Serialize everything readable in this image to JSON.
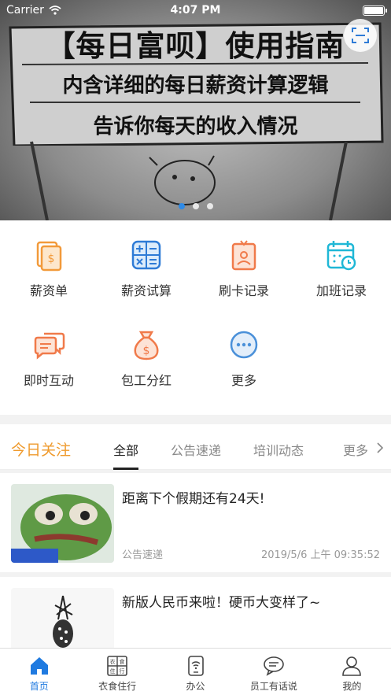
{
  "status_bar": {
    "carrier": "Carrier",
    "time": "4:07 PM"
  },
  "banner": {
    "title": "【每日富呗】使用指南",
    "line1": "内含详细的每日薪资计算逻辑",
    "line2": "告诉你每天的收入情况",
    "page_count": 3,
    "active_page": 1
  },
  "grid": [
    {
      "label": "薪资单",
      "icon": "salary-slip-icon",
      "color": "#f29a3a"
    },
    {
      "label": "薪资试算",
      "icon": "calculator-icon",
      "color": "#2e7bd6"
    },
    {
      "label": "刷卡记录",
      "icon": "badge-card-icon",
      "color": "#f07a4a"
    },
    {
      "label": "加班记录",
      "icon": "overtime-calendar-icon",
      "color": "#1fb7d6"
    },
    {
      "label": "即时互动",
      "icon": "chat-bubbles-icon",
      "color": "#f07a4a"
    },
    {
      "label": "包工分红",
      "icon": "money-bag-icon",
      "color": "#f07a4a"
    },
    {
      "label": "更多",
      "icon": "more-icon",
      "color": "#4a90d9"
    }
  ],
  "today": {
    "title": "今日关注",
    "tabs": [
      "全部",
      "公告速递",
      "培训动态",
      "更多"
    ],
    "active_tab": 0
  },
  "news": [
    {
      "title": "距离下个假期还有24天!",
      "tag": "公告速递",
      "time": "2019/5/6 上午 09:35:52"
    },
    {
      "title": "新版人民币来啦！硬币大变样了~",
      "tag": "",
      "time": ""
    }
  ],
  "bottom_nav": [
    {
      "label": "首页",
      "icon": "home-icon",
      "active": true
    },
    {
      "label": "衣食住行",
      "icon": "lifestyle-grid-icon",
      "active": false
    },
    {
      "label": "办公",
      "icon": "office-phone-icon",
      "active": false
    },
    {
      "label": "员工有话说",
      "icon": "speech-bubble-icon",
      "active": false
    },
    {
      "label": "我的",
      "icon": "profile-icon",
      "active": false
    }
  ],
  "colors": {
    "accent": "#1f7ae0",
    "today_title": "#ef9a2c"
  }
}
